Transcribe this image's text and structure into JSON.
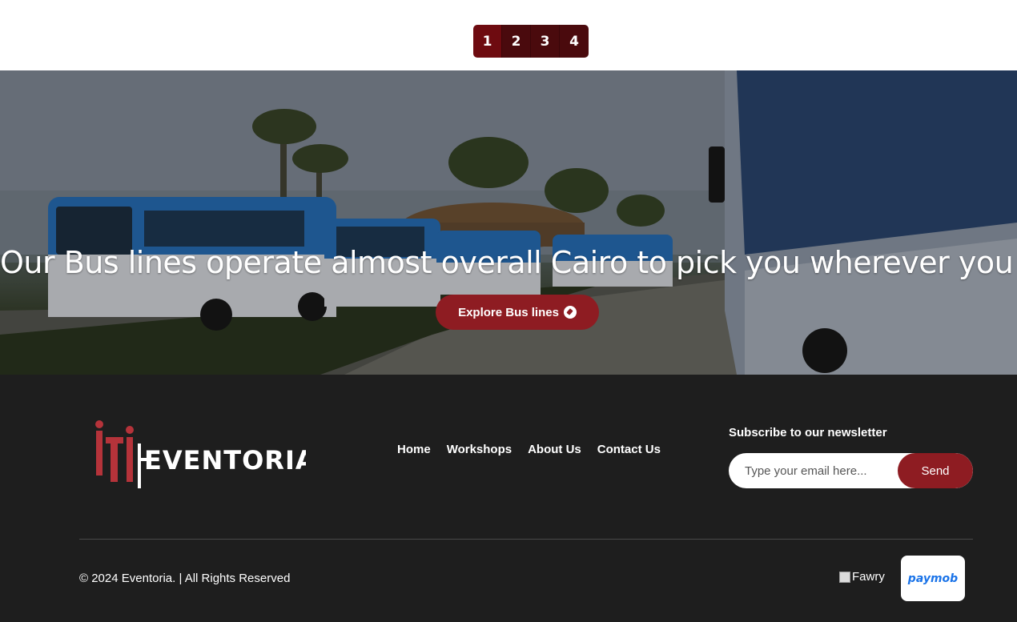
{
  "pagination": {
    "pages": [
      "1",
      "2",
      "3",
      "4"
    ],
    "active_page": "1"
  },
  "hero": {
    "title": "Our Bus lines operate almost overall Cairo to pick you wherever you are.",
    "button_label": "Explore Bus lines",
    "button_icon": "compass-icon"
  },
  "footer": {
    "logo_text": "EVENTORIA",
    "logo_mark": "iti",
    "nav": [
      "Home",
      "Workshops",
      "About Us",
      "Contact Us"
    ],
    "newsletter": {
      "title": "Subscribe to our newsletter",
      "placeholder": "Type your email here...",
      "button_label": "Send"
    },
    "copyright": "© 2024 Eventoria. | All Rights Reserved",
    "payment": {
      "fawry_alt": "Fawry",
      "paymob": "paymob"
    },
    "colors": {
      "accent": "#8e1c22",
      "background": "#1e1e1e"
    }
  }
}
